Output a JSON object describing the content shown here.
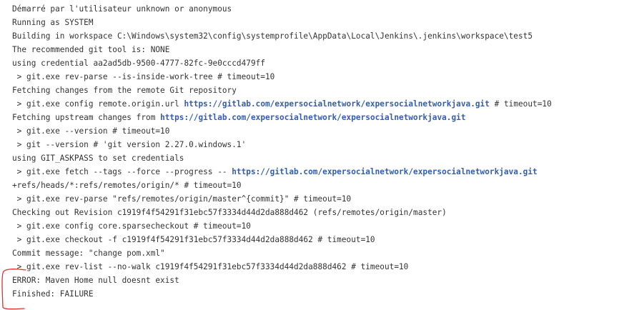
{
  "console": {
    "lines": [
      {
        "segments": [
          {
            "text": "Démarré par l'utilisateur unknown or anonymous"
          }
        ]
      },
      {
        "segments": [
          {
            "text": "Running as SYSTEM"
          }
        ]
      },
      {
        "segments": [
          {
            "text": "Building in workspace C:\\Windows\\system32\\config\\systemprofile\\AppData\\Local\\Jenkins\\.jenkins\\workspace\\test5"
          }
        ]
      },
      {
        "segments": [
          {
            "text": "The recommended git tool is: NONE"
          }
        ]
      },
      {
        "segments": [
          {
            "text": "using credential aa2ad5db-9500-4777-82fc-9e0cccd479ff"
          }
        ]
      },
      {
        "segments": [
          {
            "text": " > git.exe rev-parse --is-inside-work-tree # timeout=10"
          }
        ]
      },
      {
        "segments": [
          {
            "text": "Fetching changes from the remote Git repository"
          }
        ]
      },
      {
        "segments": [
          {
            "text": " > git.exe config remote.origin.url "
          },
          {
            "text": "https://gitlab.com/expersocialnetwork/expersocialnetworkjava.git",
            "link": true
          },
          {
            "text": " # timeout=10"
          }
        ]
      },
      {
        "segments": [
          {
            "text": "Fetching upstream changes from "
          },
          {
            "text": "https://gitlab.com/expersocialnetwork/expersocialnetworkjava.git",
            "link": true
          }
        ]
      },
      {
        "segments": [
          {
            "text": " > git.exe --version # timeout=10"
          }
        ]
      },
      {
        "segments": [
          {
            "text": " > git --version # 'git version 2.27.0.windows.1'"
          }
        ]
      },
      {
        "segments": [
          {
            "text": "using GIT_ASKPASS to set credentials"
          }
        ]
      },
      {
        "segments": [
          {
            "text": " > git.exe fetch --tags --force --progress -- "
          },
          {
            "text": "https://gitlab.com/expersocialnetwork/expersocialnetworkjava.git",
            "link": true
          }
        ]
      },
      {
        "segments": [
          {
            "text": "+refs/heads/*:refs/remotes/origin/* # timeout=10"
          }
        ]
      },
      {
        "segments": [
          {
            "text": " > git.exe rev-parse \"refs/remotes/origin/master^{commit}\" # timeout=10"
          }
        ]
      },
      {
        "segments": [
          {
            "text": "Checking out Revision c1919f4f54291f31ebc57f3334d44d2da888d462 (refs/remotes/origin/master)"
          }
        ]
      },
      {
        "segments": [
          {
            "text": " > git.exe config core.sparsecheckout # timeout=10"
          }
        ]
      },
      {
        "segments": [
          {
            "text": " > git.exe checkout -f c1919f4f54291f31ebc57f3334d44d2da888d462 # timeout=10"
          }
        ]
      },
      {
        "segments": [
          {
            "text": "Commit message: \"change pom.xml\""
          }
        ]
      },
      {
        "segments": [
          {
            "text": " > git.exe rev-list --no-walk c1919f4f54291f31ebc57f3334d44d2da888d462 # timeout=10"
          }
        ]
      },
      {
        "segments": [
          {
            "text": "ERROR: Maven Home null doesnt exist"
          }
        ]
      },
      {
        "segments": [
          {
            "text": "Finished: FAILURE"
          }
        ]
      }
    ]
  },
  "colors": {
    "text": "#333333",
    "link": "#335eae",
    "annotation": "#e03030",
    "background": "#ffffff"
  }
}
